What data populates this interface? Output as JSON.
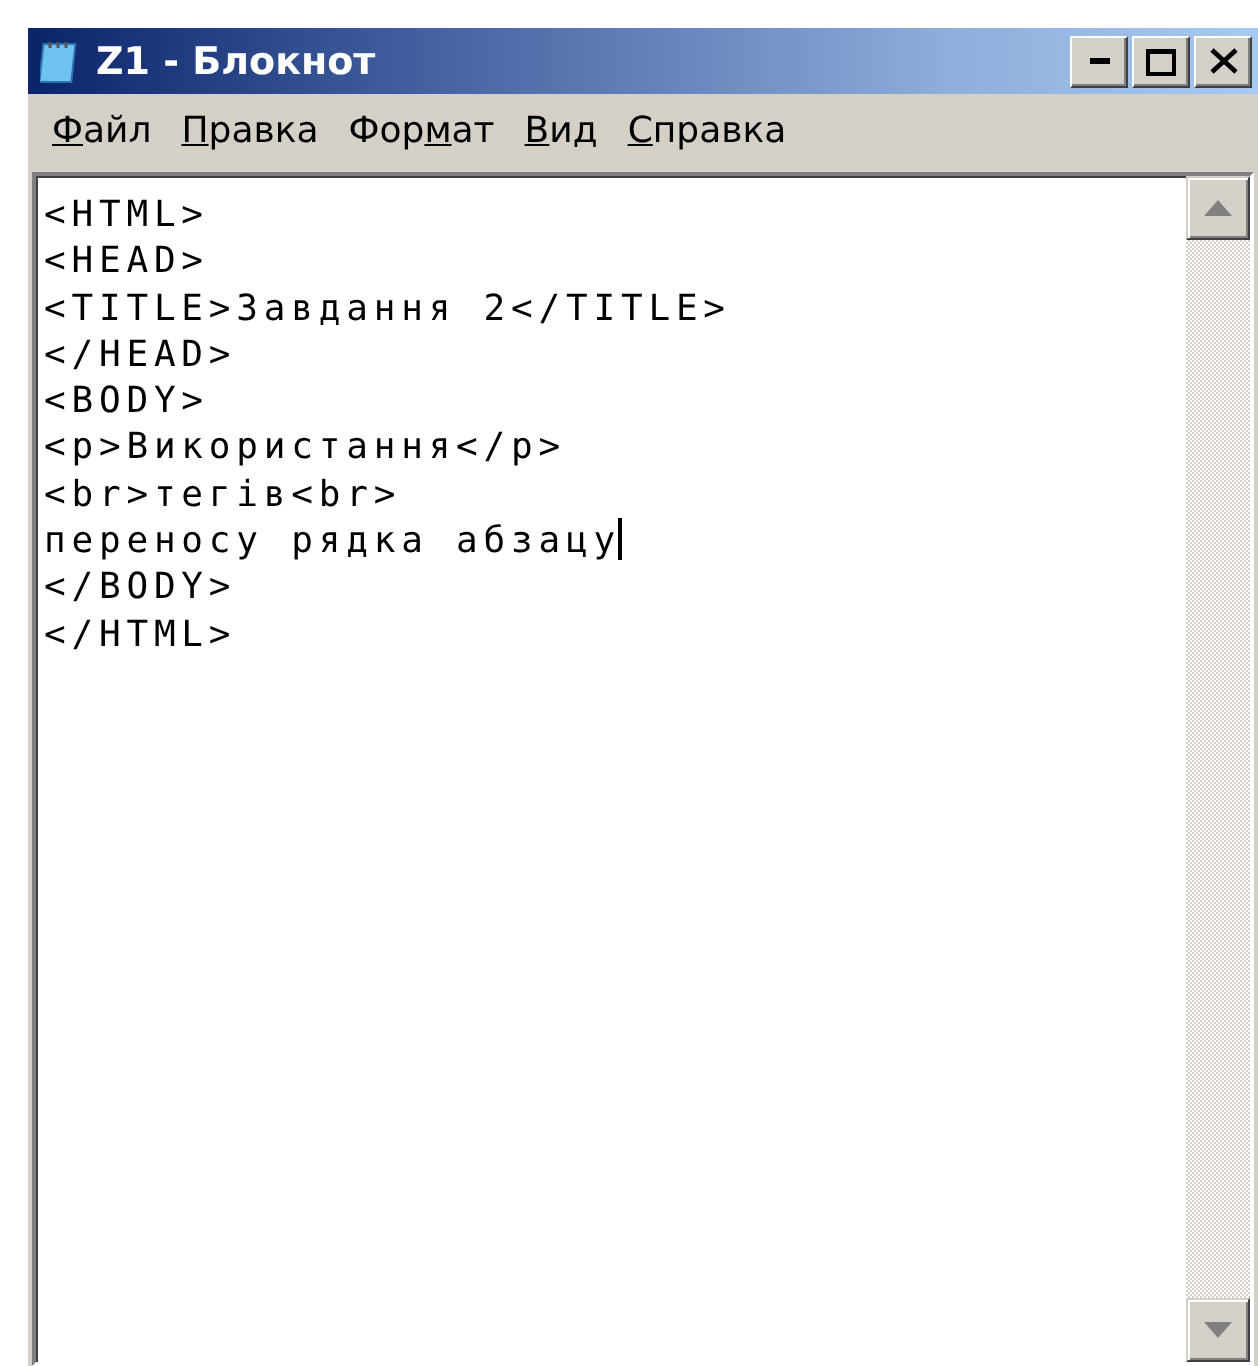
{
  "window": {
    "title": "Z1 - Блокнот"
  },
  "menu": [
    {
      "key": "Ф",
      "post": "айл"
    },
    {
      "key": "П",
      "post": "равка"
    },
    {
      "pre": "Фор",
      "key": "м",
      "post": "ат"
    },
    {
      "key": "В",
      "post": "ид"
    },
    {
      "key": "С",
      "post": "правка"
    }
  ],
  "editor": {
    "lines": [
      {
        "text": "<HTML>",
        "caret": false
      },
      {
        "text": "<HEAD>",
        "caret": false
      },
      {
        "text": "<TITLE>Завдання 2</TITLE>",
        "caret": false
      },
      {
        "text": "</HEAD>",
        "caret": false
      },
      {
        "text": "<BODY>",
        "caret": false
      },
      {
        "text": "<p>Використання</p>",
        "caret": false
      },
      {
        "text": "<br>тегів<br>",
        "caret": false
      },
      {
        "text": "переносу рядка абзацу",
        "caret": true
      },
      {
        "text": "</BODY>",
        "caret": false
      },
      {
        "text": "</HTML>",
        "caret": false
      }
    ]
  }
}
